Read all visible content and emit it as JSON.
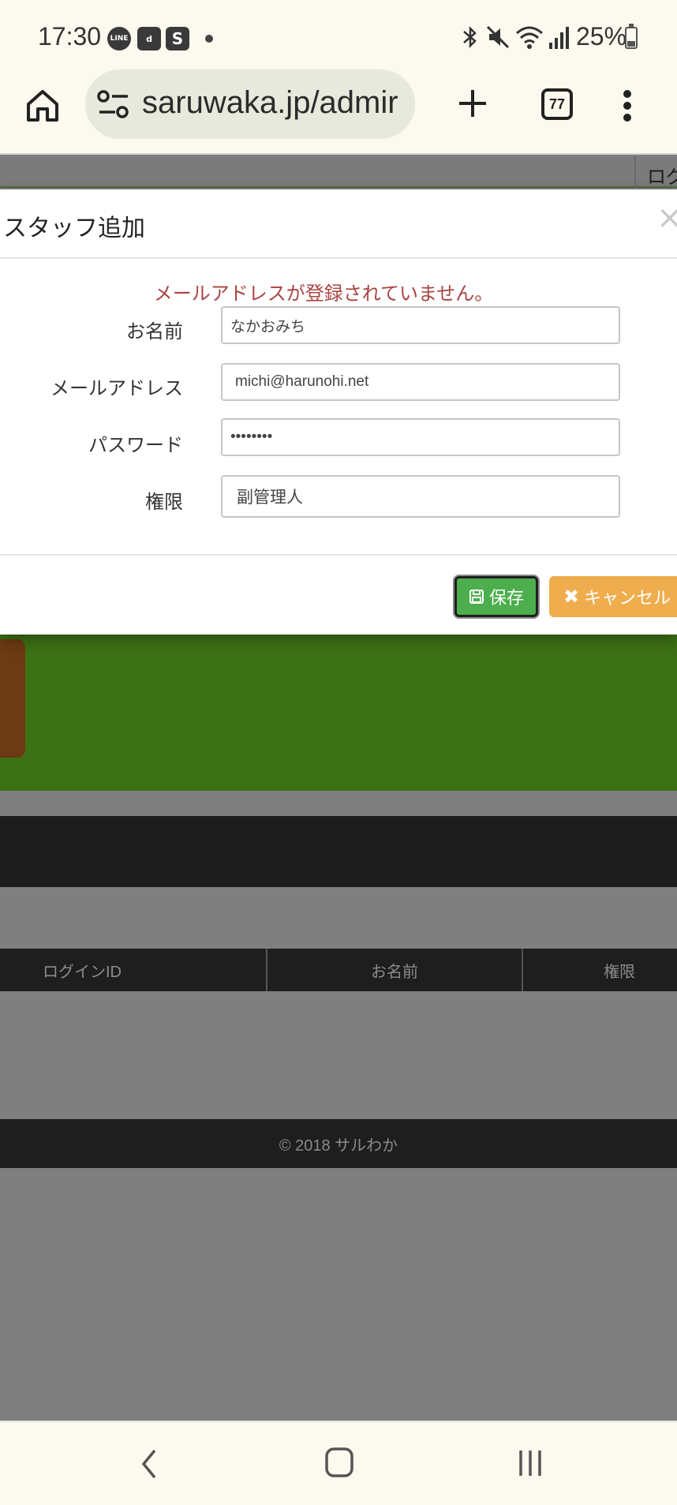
{
  "status_bar": {
    "time": "17:30",
    "icons": [
      "line-icon",
      "d-app-icon",
      "s-icon",
      "dot-icon"
    ],
    "battery": "25%"
  },
  "browser": {
    "url": "saruwaka.jp/admir",
    "tab_count": "77"
  },
  "page": {
    "login_link": "ログ",
    "table_headers": [
      "ログインID",
      "お名前",
      "権限"
    ],
    "footer": "© 2018 サルわか"
  },
  "modal": {
    "title": "スタッフ追加",
    "error": "メールアドレスが登録されていません。",
    "fields": {
      "name": {
        "label": "お名前",
        "value": "なかおみち"
      },
      "email": {
        "label": "メールアドレス",
        "value": "michi@harunohi.net"
      },
      "password": {
        "label": "パスワード",
        "value": "••••••••"
      },
      "role": {
        "label": "権限",
        "value": "副管理人"
      }
    },
    "save_label": "保存",
    "cancel_label": "キャンセル"
  },
  "colors": {
    "save": "#4cae4c",
    "cancel": "#f0ad4e",
    "error": "#a94442",
    "green_band": "#3d7115"
  }
}
